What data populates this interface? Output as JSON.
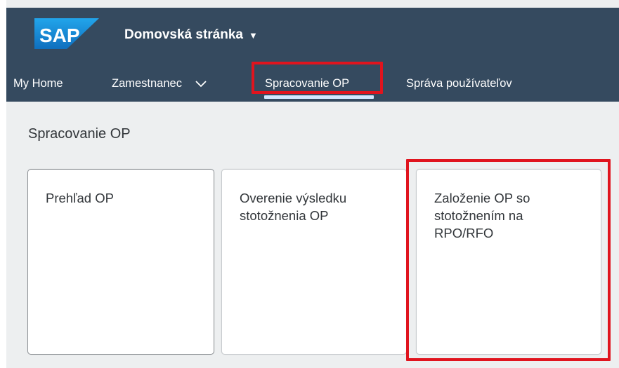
{
  "shell": {
    "logo_text": "SAP",
    "home_title": "Domovská stránka",
    "colors": {
      "shell_bg": "#354a5f",
      "logo_blue": "#1a8ad6",
      "highlight": "#e0141e"
    }
  },
  "tabs": [
    {
      "label": "My Home"
    },
    {
      "label": "Zamestnanec"
    },
    {
      "label": "Spracovanie OP",
      "selected": true
    },
    {
      "label": "Správa používateľov"
    }
  ],
  "section": {
    "title": "Spracovanie OP"
  },
  "tiles": [
    {
      "title": "Prehľad OP"
    },
    {
      "title": "Overenie výsledku\nstotožnenia OP"
    },
    {
      "title": "Založenie OP so\nstotožnením na\nRPO/RFO"
    }
  ]
}
